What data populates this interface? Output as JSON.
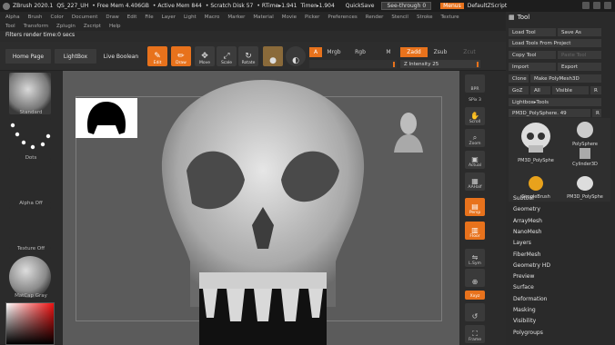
{
  "titlebar": {
    "app": "ZBrush 2020.1",
    "doc": "QS_227_UH",
    "free_mem": "• Free Mem 4.406GB",
    "active_mem": "• Active Mem 844",
    "scratch": "• Scratch Disk 57",
    "rtime": "• RTime▸1.941",
    "timer": "Timer▸1.904",
    "quicksave": "QuickSave",
    "seethrough": "See-through 0",
    "menus": "Menus",
    "default_script": "DefaultZScript"
  },
  "menubar": [
    "Alpha",
    "Brush",
    "Color",
    "Document",
    "Draw",
    "Edit",
    "File",
    "Layer",
    "Light",
    "Macro",
    "Marker",
    "Material",
    "Movie",
    "Picker",
    "Preferences",
    "Render",
    "Stencil",
    "Stroke",
    "Texture"
  ],
  "menubar2": [
    "Tool",
    "Transform",
    "Zplugin",
    "Zscript",
    "Help"
  ],
  "status_text": "Filters render time:0 secs",
  "shelf": {
    "home_page": "Home Page",
    "lightbox": "LightBox",
    "live_boolean": "Live Boolean",
    "edit": "Edit",
    "draw": "Draw",
    "move": "Move",
    "scale": "Scale",
    "rotate": "Rotate",
    "a_label": "A",
    "mrgb": "Mrgb",
    "rgb": "Rgb",
    "m": "M",
    "zadd": "Zadd",
    "zsub": "Zsub",
    "zcut": "Zcut",
    "z_intensity": "Z Intensity 25"
  },
  "left_shelf": {
    "standard": "Standard",
    "dots": "Dots",
    "alpha_off": "Alpha Off",
    "texture_off": "Texture Off",
    "matcap": "MatCap Gray"
  },
  "right_shelf": {
    "bpr": "BPR",
    "spix": "SPix 3",
    "scroll": "Scroll",
    "zoom": "Zoom",
    "actual": "Actual",
    "aahalf": "AAHalf",
    "persp": "Persp",
    "floor": "Floor",
    "lsym": "L.Sym",
    "xyz": "Xxyz",
    "frame": "Frame"
  },
  "tool_panel": {
    "title": "Tool",
    "load_tool": "Load Tool",
    "save_as": "Save As",
    "load_tools_from_project": "Load Tools From Project",
    "copy_tool": "Copy Tool",
    "paste_tool": "Paste Tool",
    "import": "Import",
    "export": "Export",
    "clone": "Clone",
    "make_polymesh": "Make PolyMesh3D",
    "goz": "GoZ",
    "all": "All",
    "visible": "Visible",
    "r": "R",
    "lightbox_tools": "Lightbox▸Tools",
    "current_tool": "PM3D_PolySphere. 49",
    "r2": "R",
    "tools": [
      "PM3D_PolySphe",
      "PolySphere",
      "Cylinder3D",
      "SimpleBrush",
      "PM3D_PolySphe"
    ],
    "subpalettes": [
      "Subtool",
      "Geometry",
      "ArrayMesh",
      "NanoMesh",
      "Layers",
      "FiberMesh",
      "Geometry HD",
      "Preview",
      "Surface",
      "Deformation",
      "Masking",
      "Visibility",
      "Polygroups"
    ]
  },
  "colors": {
    "accent": "#e8721c",
    "background": "#2b2b2b",
    "canvas": "#5b5b5b"
  }
}
